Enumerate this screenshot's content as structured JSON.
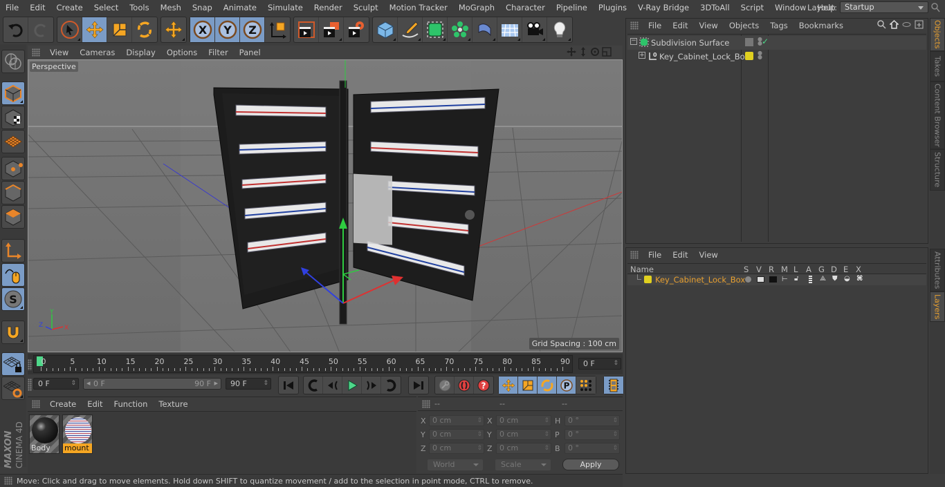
{
  "menubar": {
    "items": [
      "File",
      "Edit",
      "Create",
      "Select",
      "Tools",
      "Mesh",
      "Snap",
      "Animate",
      "Simulate",
      "Render",
      "Sculpt",
      "Motion Tracker",
      "MoGraph",
      "Character",
      "Pipeline",
      "Plugins",
      "V-Ray Bridge",
      "3DToAll",
      "Script",
      "Window",
      "Help"
    ],
    "layout_label": "Layout:",
    "layout_value": "Startup"
  },
  "toolbar": {
    "groups": [
      [
        "undo-icon",
        "redo-icon"
      ],
      [
        "live-selection-icon",
        "move-icon",
        "scale-icon",
        "rotate-icon"
      ],
      [
        "recent-tool-icon"
      ],
      [
        "x-axis-icon",
        "y-axis-icon",
        "z-axis-icon",
        "coordinate-system-icon"
      ],
      [
        "render-view-icon",
        "render-picture-viewer-icon",
        "render-settings-icon"
      ],
      [
        "cube-icon",
        "pen-spline-icon",
        "subdivision-surface-icon",
        "cloner-icon",
        "deformer-icon",
        "floor-icon",
        "camera-icon",
        "light-icon"
      ]
    ]
  },
  "left_tools": [
    "make-editable-icon",
    "model-mode-icon",
    "texture-mode-icon",
    "workplane-mode-icon",
    "points-mode-icon",
    "edges-mode-icon",
    "polygons-mode-icon",
    "axis-mode-icon",
    "tweak-mode-icon",
    "solo-mode-icon",
    "snap-icon",
    "workplane-lock-icon",
    "workplane-rotate-icon"
  ],
  "brand": {
    "line1": "MAXON",
    "line2": "CINEMA 4D"
  },
  "viewport": {
    "menu": [
      "View",
      "Cameras",
      "Display",
      "Options",
      "Filter",
      "Panel"
    ],
    "camera_label": "Perspective",
    "grid_spacing": "Grid Spacing : 100 cm",
    "nav_icons": [
      "pan-icon",
      "dolly-icon",
      "orbit-icon",
      "maximize-icon"
    ],
    "axis_labels": {
      "x": "X",
      "y": "Y",
      "z": "Z"
    }
  },
  "timeline": {
    "ticks": [
      0,
      5,
      10,
      15,
      20,
      25,
      30,
      35,
      40,
      45,
      50,
      55,
      60,
      65,
      70,
      75,
      80,
      85,
      90
    ],
    "current_frame": "0 F",
    "current_marker": 0
  },
  "transport": {
    "start_field": "0 F",
    "range_start": "0 F",
    "range_end": "90 F",
    "end_field": "90 F"
  },
  "materials": {
    "menu": [
      "Create",
      "Edit",
      "Function",
      "Texture"
    ],
    "items": [
      {
        "name": "Body",
        "selected": false
      },
      {
        "name": "mount",
        "selected": true
      }
    ]
  },
  "coordinates": {
    "headers": [
      "--",
      "--",
      "--"
    ],
    "rows": [
      {
        "l1": "X",
        "v1": "0 cm",
        "l2": "X",
        "v2": "0 cm",
        "l3": "H",
        "v3": "0 °"
      },
      {
        "l1": "Y",
        "v1": "0 cm",
        "l2": "Y",
        "v2": "0 cm",
        "l3": "P",
        "v3": "0 °"
      },
      {
        "l1": "Z",
        "v1": "0 cm",
        "l2": "Z",
        "v2": "0 cm",
        "l3": "B",
        "v3": "0 °"
      }
    ],
    "mode": "World",
    "transform": "Scale",
    "apply_label": "Apply"
  },
  "status": {
    "text": "Move: Click and drag to move elements. Hold down SHIFT to quantize movement / add to the selection in point mode, CTRL to remove."
  },
  "objects_panel": {
    "menu": [
      "File",
      "Edit",
      "View",
      "Objects",
      "Tags",
      "Bookmarks"
    ],
    "items": [
      {
        "name": "Subdivision Surface",
        "expanded": true
      },
      {
        "name": "Key_Cabinet_Lock_Box",
        "expanded": false
      }
    ]
  },
  "layers_panel": {
    "menu": [
      "File",
      "Edit",
      "View"
    ],
    "columns": [
      "Name",
      "S",
      "V",
      "R",
      "M",
      "L",
      "A",
      "G",
      "D",
      "E",
      "X"
    ],
    "rows": [
      {
        "name": "Key_Cabinet_Lock_Box",
        "color": "#e0d020"
      }
    ]
  },
  "side_tabs": {
    "top": [
      {
        "label": "Objects",
        "active": true
      },
      {
        "label": "Takes",
        "active": false
      },
      {
        "label": "Content Browser",
        "active": false
      },
      {
        "label": "Structure",
        "active": false
      }
    ],
    "bottom": [
      {
        "label": "Attributes",
        "active": false
      },
      {
        "label": "Layers",
        "active": true
      }
    ]
  },
  "colors": {
    "accent_orange": "#e8a030",
    "active_blue": "#7b9cc6",
    "layer_yellow": "#e0d020",
    "timeline_marker": "#4ed88a"
  }
}
